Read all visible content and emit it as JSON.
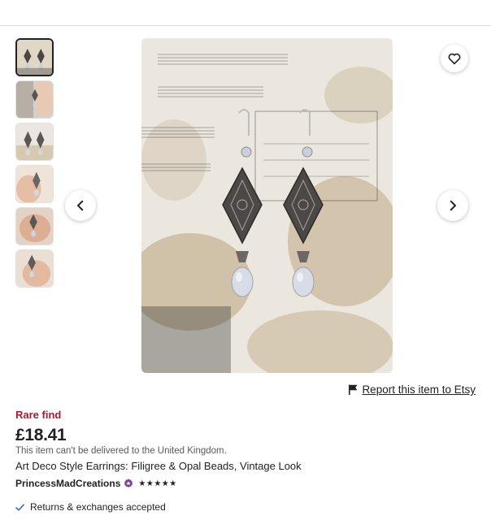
{
  "gallery": {
    "thumbnails": [
      {
        "name": "thumbnail-1",
        "selected": true
      },
      {
        "name": "thumbnail-2",
        "selected": false
      },
      {
        "name": "thumbnail-3",
        "selected": false
      },
      {
        "name": "thumbnail-4",
        "selected": false
      },
      {
        "name": "thumbnail-5",
        "selected": false
      },
      {
        "name": "thumbnail-6",
        "selected": false
      }
    ],
    "prev_icon": "chevron-left-icon",
    "next_icon": "chevron-right-icon",
    "favorite_icon": "heart-outline-icon"
  },
  "report": {
    "label": "Report this item to Etsy",
    "icon": "flag-icon"
  },
  "listing": {
    "badge": "Rare find",
    "price": "£18.41",
    "delivery_notice": "This item can't be delivered to the United Kingdom.",
    "title": "Art Deco Style Earrings: Filigree & Opal Beads, Vintage Look",
    "shop_name": "PrincessMadCreations",
    "star_seller_icon": "star-seller-badge-icon",
    "rating_stars": "★★★★★",
    "rating_value": 5,
    "returns": "Returns & exchanges accepted",
    "returns_icon": "checkmark-icon"
  },
  "colors": {
    "badge_red": "#a61a2e",
    "star_seller_purple": "#7e3fa8",
    "check_blue": "#2f6fdb",
    "text": "#222222",
    "muted": "#595959"
  }
}
